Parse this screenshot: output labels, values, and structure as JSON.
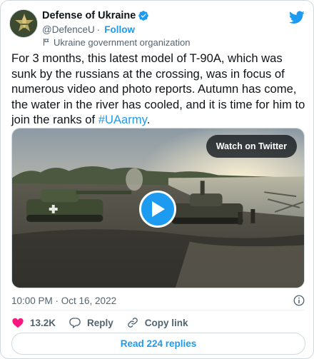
{
  "author": {
    "name": "Defense of Ukraine",
    "handle": "@DefenceU",
    "follow_label": "Follow",
    "separator": "·",
    "label": "Ukraine government organization"
  },
  "tweet": {
    "text_before_hashtag": "For 3 months, this latest model of T-90A, which was sunk by the russians at the crossing, was in focus of numerous video and photo reports. Autumn has come, the water in the river has cooled, and it is time for him to join the ranks of ",
    "hashtag": "#UAarmy",
    "text_after_hashtag": "."
  },
  "media": {
    "watch_label": "Watch on Twitter",
    "play_icon": "play-icon"
  },
  "meta": {
    "timestamp": "10:00 PM · Oct 16, 2022",
    "info_icon": "info-icon"
  },
  "actions": {
    "like_count": "13.2K",
    "reply_label": "Reply",
    "copy_link_label": "Copy link"
  },
  "replies_button": "Read 224 replies",
  "colors": {
    "accent": "#1d9bf0",
    "like_red": "#f91880",
    "text_primary": "#0f1419",
    "text_secondary": "#536471",
    "border": "#cfd9de"
  }
}
